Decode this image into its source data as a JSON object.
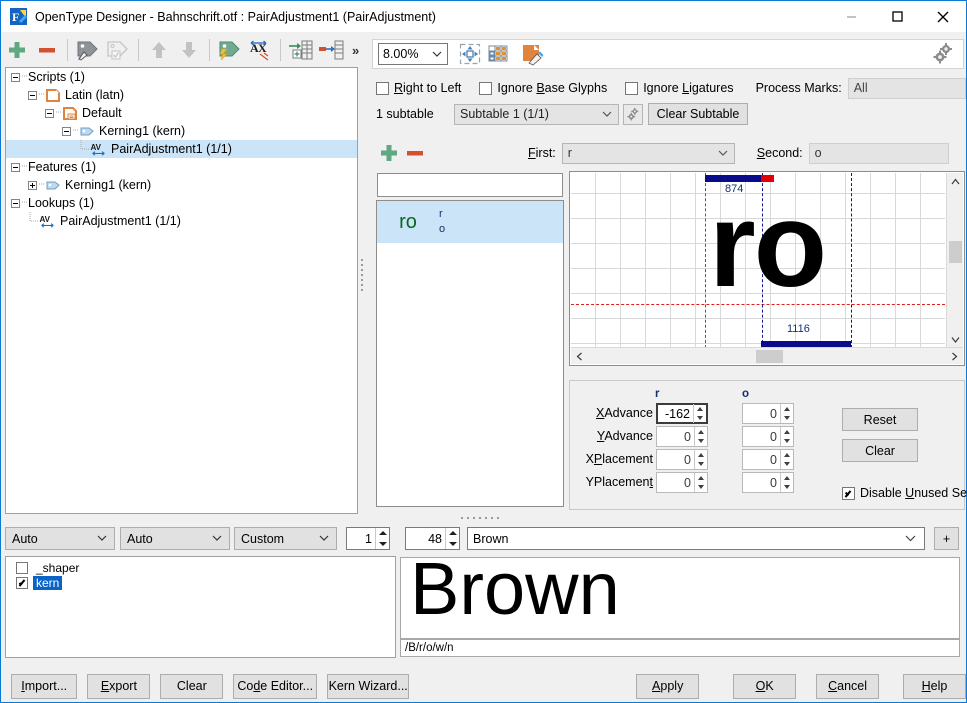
{
  "window": {
    "title": "OpenType Designer - Bahnschrift.otf : PairAdjustment1 (PairAdjustment)",
    "app_icon": "opentype-designer-icon",
    "minimize": "—",
    "maximize": "☐",
    "close": "✕"
  },
  "toolbar": {
    "items": [
      {
        "name": "add-icon",
        "glyph": "plus"
      },
      {
        "name": "remove-icon",
        "glyph": "minus"
      },
      {
        "name": "edit-tag-icon",
        "glyph": "tag-pen"
      },
      {
        "name": "check-tag-icon",
        "glyph": "tag-check"
      },
      {
        "name": "move-up-icon",
        "glyph": "arrow-up"
      },
      {
        "name": "move-down-icon",
        "glyph": "arrow-down"
      },
      {
        "name": "auto-tag-icon",
        "glyph": "tag-bolt"
      },
      {
        "name": "kern-pairs-icon",
        "glyph": "av-kern"
      },
      {
        "name": "insert-row-icon",
        "glyph": "row-insert"
      },
      {
        "name": "delete-row-icon",
        "glyph": "row-delete"
      }
    ],
    "overflow_label": "»"
  },
  "tree": {
    "nodes": [
      {
        "label": "Scripts (1)",
        "depth": 0,
        "expander": "minus",
        "icon": "none",
        "selected": false
      },
      {
        "label": "Latin (latn)",
        "depth": 1,
        "expander": "minus",
        "icon": "script-icon",
        "selected": false
      },
      {
        "label": "Default",
        "depth": 2,
        "expander": "minus",
        "icon": "language-icon",
        "selected": false
      },
      {
        "label": "Kerning1 (kern)",
        "depth": 3,
        "expander": "minus",
        "icon": "feature-icon",
        "selected": false
      },
      {
        "label": "PairAdjustment1 (1/1)",
        "depth": 4,
        "expander": "none",
        "icon": "av-lookup-icon",
        "selected": true
      },
      {
        "label": "Features (1)",
        "depth": 0,
        "expander": "minus",
        "icon": "none",
        "selected": false
      },
      {
        "label": "Kerning1 (kern)",
        "depth": 1,
        "expander": "plus",
        "icon": "feature-icon",
        "selected": false
      },
      {
        "label": "Lookups (1)",
        "depth": 0,
        "expander": "minus",
        "icon": "none",
        "selected": false
      },
      {
        "label": "PairAdjustment1 (1/1)",
        "depth": 1,
        "expander": "none",
        "icon": "av-lookup-icon",
        "selected": false
      }
    ]
  },
  "view_toolbar": {
    "zoom_value": "8.00%",
    "fit_icon": "fit-to-window-icon",
    "grid_icon": "show-grid-icon",
    "edit_glyph_icon": "edit-glyph-icon",
    "settings_icon": "settings-gears-icon"
  },
  "lookup_options": {
    "checkboxes": [
      {
        "name": "right-to-left",
        "label_pre": "",
        "label_u": "R",
        "label_post": "ight to Left",
        "checked": false
      },
      {
        "name": "ignore-base-glyphs",
        "label_pre": "Ignore ",
        "label_u": "B",
        "label_post": "ase Glyphs",
        "checked": false
      },
      {
        "name": "ignore-ligatures",
        "label_pre": "Ignore ",
        "label_u": "L",
        "label_post": "igatures",
        "checked": false
      }
    ],
    "process_marks_label": "Process Marks:",
    "process_marks_value": "All",
    "subtable_count": "1 subtable",
    "subtable_value": "Subtable 1 (1/1)",
    "subtable_settings_icon": "subtable-gear-icon",
    "clear_subtable_label": "Clear Subtable"
  },
  "pair_header": {
    "add_icon": "add-pair-icon",
    "remove_icon": "remove-pair-icon",
    "first_label_u": "F",
    "first_label_rest": "irst:",
    "first_value": "r",
    "second_label_u": "S",
    "second_label_rest": "econd:",
    "second_value": "o"
  },
  "pair_list": {
    "filter_value": "",
    "filter_placeholder": "",
    "items": [
      {
        "glyphs": "ro",
        "first_name": "r",
        "second_name": "o",
        "selected": true
      }
    ]
  },
  "glyph_preview": {
    "text": "ro",
    "first_advance": "874",
    "second_advance": "1116",
    "scroll_left_icon": "chevron-left-icon",
    "scroll_right_icon": "chevron-right-icon",
    "scroll_up_icon": "chevron-up-icon",
    "scroll_down_icon": "chevron-down-icon"
  },
  "value_panel": {
    "col_first": "r",
    "col_second": "o",
    "rows": [
      {
        "name": "xadvance",
        "u": "X",
        "rest": "Advance",
        "first": "-162",
        "second": "0",
        "active": true
      },
      {
        "name": "yadvance",
        "u": "Y",
        "rest": "Advance",
        "first": "0",
        "second": "0",
        "active": false
      },
      {
        "name": "xplacement",
        "u": "P",
        "pre": "X",
        "rest": "lacement",
        "first": "0",
        "second": "0",
        "active": false
      },
      {
        "name": "yplacement",
        "u": "t",
        "pre": "YPlacemen",
        "rest": "",
        "first": "0",
        "second": "0",
        "active": false
      }
    ],
    "reset_label": "Reset",
    "clear_label": "Clear",
    "disable_unused_pre": "Disable ",
    "disable_unused_u": "U",
    "disable_unused_post": "nused Set",
    "disable_unused_checked": true
  },
  "lower_controls": {
    "script_combo": "Auto",
    "language_combo": "Auto",
    "direction_combo": "Custom",
    "instance_value": "1",
    "font_size_value": "48",
    "sample_text": "Brown",
    "add_sample_label": "+",
    "features": [
      {
        "label": "_shaper",
        "checked": false,
        "selected": false
      },
      {
        "label": "kern",
        "checked": true,
        "selected": true
      }
    ],
    "preview_text": "Brown",
    "glyph_code": "/B/r/o/w/n"
  },
  "footer": {
    "buttons": [
      {
        "name": "import-button",
        "u": "I",
        "pre": "",
        "post": "mport...",
        "w": "w1"
      },
      {
        "name": "export-button",
        "u": "E",
        "pre": "",
        "post": "xport",
        "w": ""
      },
      {
        "name": "clear-button",
        "u": "",
        "pre": "Clear",
        "post": "",
        "w": ""
      },
      {
        "name": "code-editor-button",
        "u": "d",
        "pre": "Co",
        "post": "e Editor...",
        "w": "w2"
      },
      {
        "name": "kern-wizard-button",
        "u": "",
        "pre": "Kern Wizard...",
        "post": "",
        "w": "w3"
      }
    ],
    "right_buttons": [
      {
        "name": "apply-button",
        "u": "A",
        "pre": "",
        "post": "pply",
        "w": ""
      },
      {
        "name": "ok-button",
        "u": "O",
        "pre": "",
        "post": "K",
        "w": ""
      },
      {
        "name": "cancel-button",
        "u": "C",
        "pre": "",
        "post": "ancel",
        "w": ""
      },
      {
        "name": "help-button",
        "u": "H",
        "pre": "",
        "post": "elp",
        "w": ""
      }
    ]
  },
  "colors": {
    "accent_blue": "#0a78d7",
    "green": "#5fa882",
    "red": "#d4512f",
    "orange": "#e08a3c",
    "selection": "#cce4f7",
    "glyph_green": "#0b6623",
    "advance_blue": "#0a0a8c"
  }
}
